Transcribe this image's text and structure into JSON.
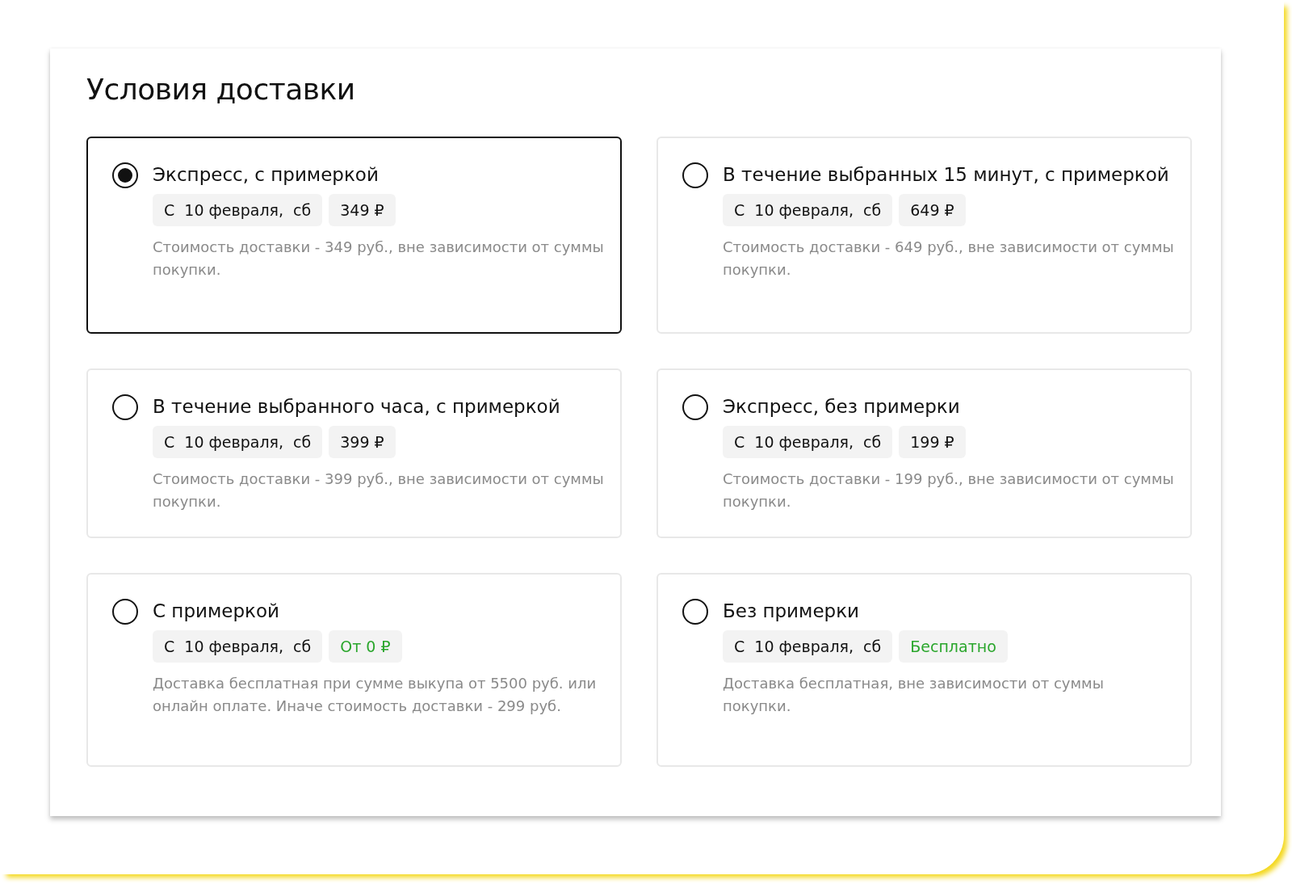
{
  "title": "Условия доставки",
  "options": [
    {
      "name": "Экспресс, с примеркой",
      "selected": true,
      "date": "С  10 февраля,  сб",
      "price": {
        "text": "349 ₽",
        "kind": "regular"
      },
      "note": "Стоимость доставки - 349 руб., вне зависимости от суммы покупки."
    },
    {
      "name": "В течение выбранных 15 минут, с примеркой",
      "selected": false,
      "date": "С  10 февраля,  сб",
      "price": {
        "text": "649 ₽",
        "kind": "regular"
      },
      "note": "Стоимость доставки - 649 руб., вне зависимости от суммы покупки."
    },
    {
      "name": "В течение выбранного часа, с примеркой",
      "selected": false,
      "date": "С  10 февраля,  сб",
      "price": {
        "text": "399 ₽",
        "kind": "regular"
      },
      "note": "Стоимость доставки - 399 руб., вне зависимости от суммы покупки."
    },
    {
      "name": "Экспресс, без примерки",
      "selected": false,
      "date": "С  10 февраля,  сб",
      "price": {
        "text": "199 ₽",
        "kind": "regular"
      },
      "note": "Стоимость доставки - 199 руб., вне зависимости от суммы покупки."
    },
    {
      "name": "С примеркой",
      "selected": false,
      "date": "С  10 февраля,  сб",
      "price": {
        "text": "От 0 ₽",
        "kind": "free"
      },
      "note": "Доставка бесплатная при сумме выкупа от 5500 руб. или онлайн оплате. Иначе стоимость доставки - 299 руб."
    },
    {
      "name": "Без примерки",
      "selected": false,
      "date": "С  10 февраля,  сб",
      "price": {
        "text": "Бесплатно",
        "kind": "free"
      },
      "note": "Доставка бесплатная, вне зависимости от суммы покупки."
    }
  ]
}
